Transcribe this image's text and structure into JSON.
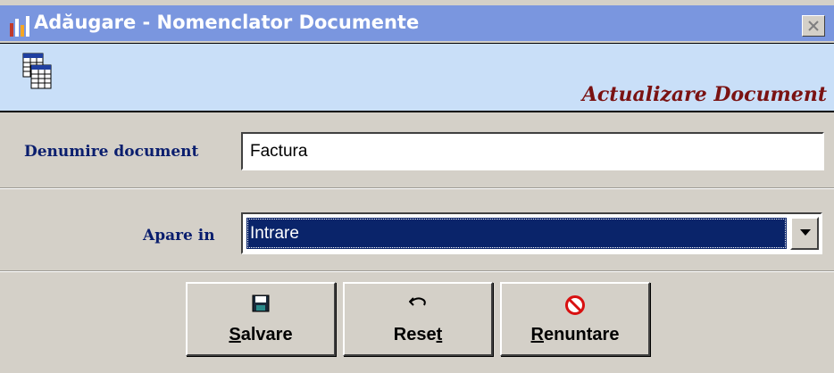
{
  "window": {
    "title": "Adăugare - Nomenclator Documente",
    "close_icon": "close-icon"
  },
  "banner": {
    "title": "Actualizare Document",
    "icon": "document-table-icon"
  },
  "form": {
    "name_label": "Denumire document",
    "name_value": "Factura",
    "appears_label": "Apare in",
    "appears_value": "Intrare"
  },
  "buttons": {
    "save": {
      "prefix": "",
      "mnemonic": "S",
      "suffix": "alvare",
      "icon": "floppy-disk-icon"
    },
    "reset": {
      "prefix": "Rese",
      "mnemonic": "t",
      "suffix": "",
      "icon": "undo-arrow-icon"
    },
    "cancel": {
      "prefix": "",
      "mnemonic": "R",
      "suffix": "enuntare",
      "icon": "no-entry-icon"
    }
  },
  "colors": {
    "title_bar": "#7a96df",
    "banner_bg": "#c9dff8",
    "banner_title": "#7a1212",
    "label": "#0a1e6e",
    "selection": "#0a246a",
    "cancel_icon": "#d81010"
  }
}
